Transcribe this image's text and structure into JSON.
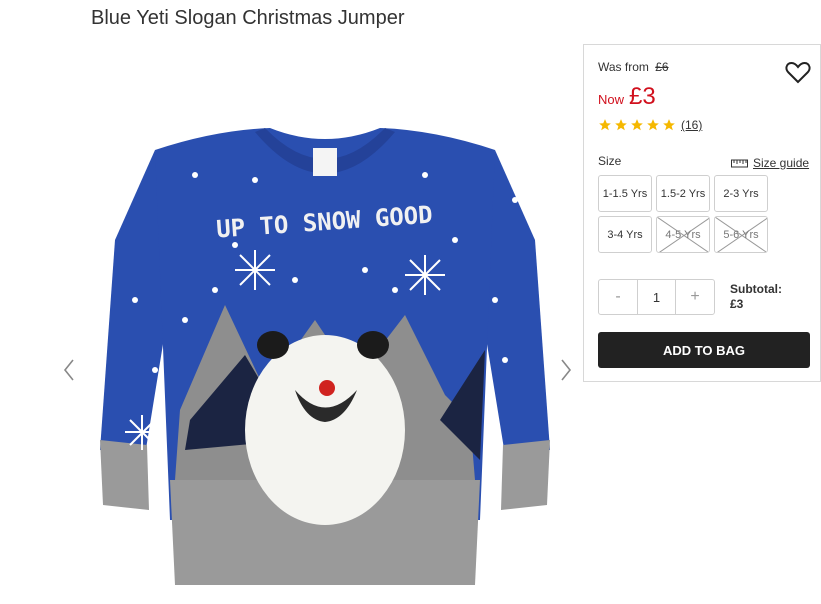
{
  "product": {
    "title": "Blue Yeti Slogan Christmas Jumper"
  },
  "price": {
    "was_label": "Was from",
    "was_value": "£6",
    "now_label": "Now",
    "now_value": "£3",
    "color": "#d1101d"
  },
  "rating": {
    "stars": 5,
    "max": 5,
    "review_count": "(16)",
    "star_color": "#f5b800"
  },
  "sizes": {
    "label": "Size",
    "guide_label": "Size guide",
    "options": [
      {
        "label": "1-1.5 Yrs",
        "available": true
      },
      {
        "label": "1.5-2 Yrs",
        "available": true
      },
      {
        "label": "2-3 Yrs",
        "available": true
      },
      {
        "label": "3-4 Yrs",
        "available": true
      },
      {
        "label": "4-5 Yrs",
        "available": false
      },
      {
        "label": "5-6 Yrs",
        "available": false
      }
    ]
  },
  "quantity": {
    "minus": "-",
    "value": "1",
    "plus": "+"
  },
  "subtotal": {
    "label": "Subtotal:",
    "value": "£3"
  },
  "cart": {
    "add_label": "ADD TO BAG"
  },
  "image": {
    "slogan": "UP TO SNOW GOOD",
    "icons": [
      "chevron-left-icon",
      "chevron-right-icon",
      "heart-icon",
      "star-icon",
      "ruler-icon"
    ]
  }
}
